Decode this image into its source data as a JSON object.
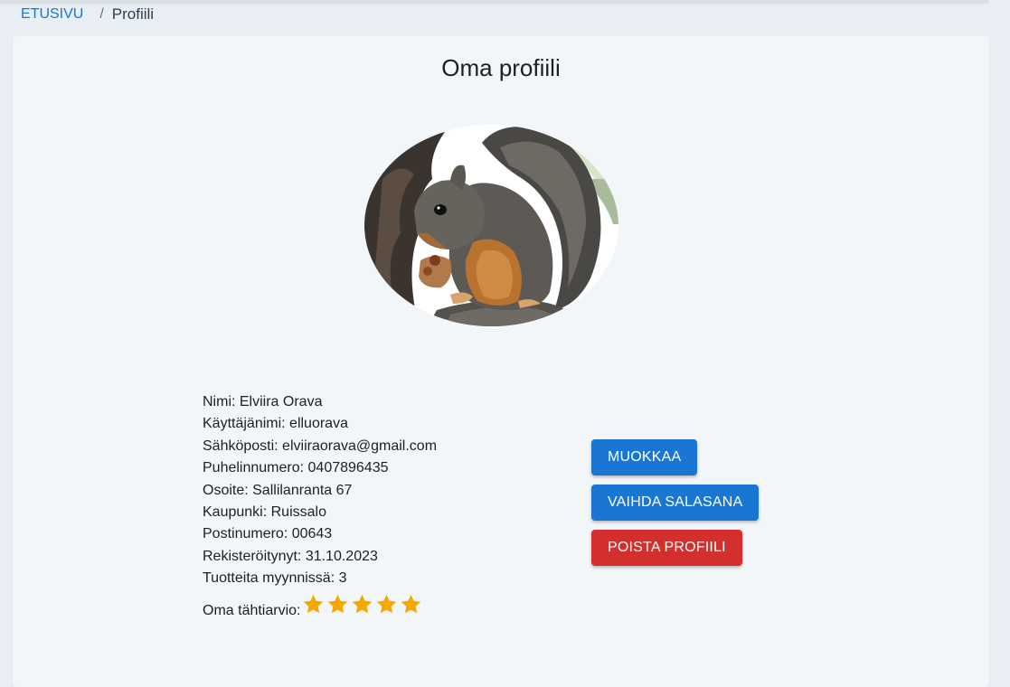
{
  "breadcrumb": {
    "home": "ETUSIVU",
    "separator": "/",
    "current": "Profiili"
  },
  "page": {
    "title": "Oma profiili"
  },
  "profile": {
    "avatar_alt": "squirrel-photo",
    "name": "Nimi: Elviira Orava",
    "username": "Käyttäjänimi: elluorava",
    "email": "Sähköposti: elviiraorava@gmail.com",
    "phone": "Puhelinnumero: 0407896435",
    "address": "Osoite: Sallilanranta 67",
    "city": "Kaupunki: Ruissalo",
    "postal_code": "Postinumero: 00643",
    "registered": "Rekisteröitynyt: 31.10.2023",
    "products_for_sale": "Tuotteita myynnissä: 3",
    "rating_label": "Oma tähtiarvio:",
    "rating": 5,
    "rating_max": 5
  },
  "actions": {
    "edit": "MUOKKAA",
    "change_password": "VAIHDA SALASANA",
    "delete_profile": "POISTA PROFIILI"
  },
  "colors": {
    "primary": "#1976d2",
    "danger": "#d32f2f",
    "star": "#f5a800",
    "background": "#e8eef3",
    "card": "#f3f6f9"
  },
  "icons": {
    "rating": "star-icon"
  }
}
